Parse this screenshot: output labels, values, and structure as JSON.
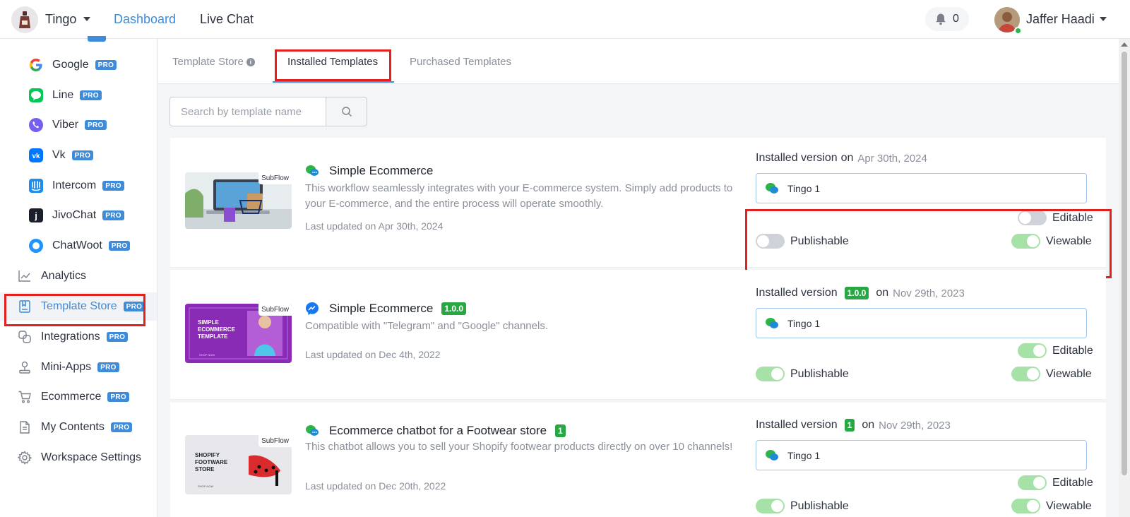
{
  "header": {
    "workspace_name": "Tingo",
    "nav": {
      "dashboard": "Dashboard",
      "live_chat": "Live Chat"
    },
    "notifications": {
      "icon": "bell-icon",
      "count": "0"
    },
    "user": {
      "name": "Jaffer Haadi",
      "status": "online"
    },
    "accent_color": "#3d8bd9"
  },
  "sidebar": {
    "pro_label": "PRO",
    "items": [
      {
        "label": "Google",
        "icon": "google-icon",
        "pro": true
      },
      {
        "label": "Line",
        "icon": "line-icon",
        "pro": true
      },
      {
        "label": "Viber",
        "icon": "viber-icon",
        "pro": true
      },
      {
        "label": "Vk",
        "icon": "vk-icon",
        "pro": true
      },
      {
        "label": "Intercom",
        "icon": "intercom-icon",
        "pro": true
      },
      {
        "label": "JivoChat",
        "icon": "jivochat-icon",
        "pro": true
      },
      {
        "label": "ChatWoot",
        "icon": "chatwoot-icon",
        "pro": true
      },
      {
        "label": "Analytics",
        "icon": "analytics-icon",
        "pro": false
      },
      {
        "label": "Template Store",
        "icon": "template-store-icon",
        "pro": true,
        "active": true
      },
      {
        "label": "Integrations",
        "icon": "integrations-icon",
        "pro": true
      },
      {
        "label": "Mini-Apps",
        "icon": "mini-apps-icon",
        "pro": true
      },
      {
        "label": "Ecommerce",
        "icon": "cart-icon",
        "pro": true
      },
      {
        "label": "My Contents",
        "icon": "document-icon",
        "pro": true
      },
      {
        "label": "Workspace Settings",
        "icon": "gear-icon",
        "pro": false
      }
    ]
  },
  "tabs": [
    {
      "label": "Template Store",
      "has_info_icon": true,
      "active": false
    },
    {
      "label": "Installed Templates",
      "active": true
    },
    {
      "label": "Purchased Templates",
      "active": false
    }
  ],
  "search": {
    "placeholder": "Search by template name",
    "value": "",
    "button_icon": "search-icon"
  },
  "templates": [
    {
      "title": "Simple Ecommerce",
      "channel_icon": "chat-bubbles-icon",
      "version_badge": "",
      "subflow_label": "SubFlow",
      "description": "This workflow seamlessly integrates with your E-commerce system. Simply add products to your E-commerce, and the entire process will operate smoothly.",
      "last_updated": "Last updated on Apr 30th, 2024",
      "installed_prefix": "Installed version",
      "installed_on": "on",
      "installed_version": "",
      "installed_date": "Apr 30th, 2024",
      "workspace": "Tingo 1",
      "editable": {
        "label": "Editable",
        "on": false
      },
      "publishable": {
        "label": "Publishable",
        "on": false
      },
      "viewable": {
        "label": "Viewable",
        "on": true
      }
    },
    {
      "title": "Simple Ecommerce",
      "channel_icon": "messenger-icon",
      "version_badge": "1.0.0",
      "subflow_label": "SubFlow",
      "thumb_text": "SIMPLE ECOMMERCE TEMPLATE",
      "description": "Compatible with \"Telegram\" and \"Google\" channels.",
      "last_updated": "Last updated on Dec 4th, 2022",
      "installed_prefix": "Installed version",
      "installed_on": "on",
      "installed_version": "1.0.0",
      "installed_date": "Nov 29th, 2023",
      "workspace": "Tingo 1",
      "editable": {
        "label": "Editable",
        "on": true
      },
      "publishable": {
        "label": "Publishable",
        "on": true
      },
      "viewable": {
        "label": "Viewable",
        "on": true
      }
    },
    {
      "title": "Ecommerce chatbot for a Footwear store",
      "channel_icon": "chat-bubbles-icon",
      "version_badge": "1",
      "subflow_label": "SubFlow",
      "thumb_text": "SHOPIFY FOOTWARE STORE",
      "description": "This chatbot allows you to sell your Shopify footwear products directly on over 10 channels!",
      "last_updated": "Last updated on Dec 20th, 2022",
      "installed_prefix": "Installed version",
      "installed_on": "on",
      "installed_version": "1",
      "installed_date": "Nov 29th, 2023",
      "workspace": "Tingo 1",
      "editable": {
        "label": "Editable",
        "on": true
      },
      "publishable": {
        "label": "Publishable",
        "on": true
      },
      "viewable": {
        "label": "Viewable",
        "on": true
      }
    }
  ],
  "colors": {
    "badge_green": "#28a745",
    "toggle_on": "#a6e2a8",
    "toggle_off": "#cfd3d9",
    "highlight_red": "#e3201e"
  }
}
